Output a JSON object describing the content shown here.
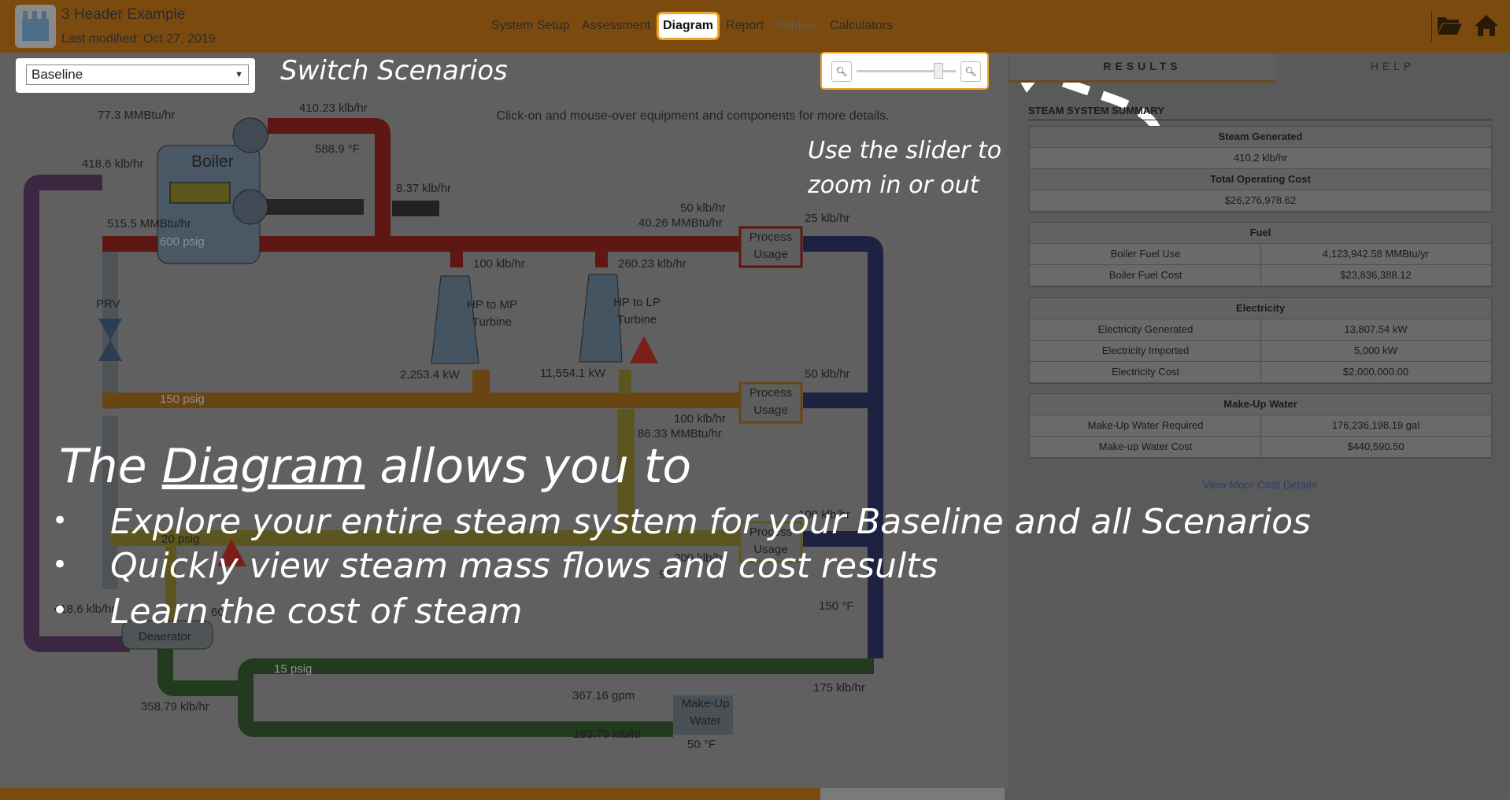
{
  "header": {
    "doc_title": "3 Header Example",
    "last_modified": "Last modified: Oct 27, 2019",
    "nav": [
      "System Setup",
      "Assessment",
      "Diagram",
      "Report",
      "Sankey",
      "Calculators"
    ]
  },
  "scenario": {
    "selected": "Baseline"
  },
  "annotations": {
    "switch_scenarios": "Switch Scenarios",
    "zoom_hint_1": "Use the slider to",
    "zoom_hint_2": "zoom in or out"
  },
  "diagram": {
    "helper": "Click-on and mouse-over equipment and components for more details.",
    "boiler": "Boiler",
    "prv": "PRV",
    "deaerator": "Deaerator",
    "makeup": "Make-Up Water",
    "process_usage": "Process Usage",
    "turbine_hp_mp": "HP to MP Turbine",
    "turbine_hp_lp": "HP to LP Turbine",
    "labels": {
      "boiler_fuel": "77.3 MMBtu/hr",
      "boiler_steam": "410.23 klb/hr",
      "boiler_temp": "588.9 °F",
      "feed_flow": "418.6 klb/hr",
      "blowdown": "8.37 klb/hr",
      "boiler_energy": "515.5 MMBtu/hr",
      "hp_header": "600 psig",
      "hp_process_flow": "50 klb/hr",
      "hp_process_energy": "40.26 MMBtu/hr",
      "hp_process_return": "25 klb/hr",
      "turbine1_flow": "100 klb/hr",
      "turbine2_flow": "260.23 klb/hr",
      "turbine1_power": "2,253.4 kW",
      "turbine2_power": "11,554.1 kW",
      "mp_header": "150 psig",
      "mp_process_return": "50 klb/hr",
      "mp_process_flow": "100 klb/hr",
      "mp_process_energy": "86.33 MMBtu/hr",
      "lp_header": "20 psig",
      "lp_process_return": "100 klb/hr",
      "lp_flow": "200 klb/hr",
      "lp_energy": "96",
      "deaerator_flow": "418.6 klb/hr",
      "deaerator_vent": "60",
      "condensate_temp": "150 °F",
      "cond_header": "15 psig",
      "return_flow": "175 klb/hr",
      "deaerator_out": "358.79 klb/hr",
      "makeup_gpm": "367.16 gpm",
      "makeup_flow": "183.79 klb/hr",
      "makeup_temp": "50 °F"
    }
  },
  "results": {
    "tabs": [
      "RESULTS",
      "HELP"
    ],
    "summary_title": "STEAM SYSTEM SUMMARY",
    "steam_generated_label": "Steam Generated",
    "steam_generated": "410.2 klb/hr",
    "total_cost_label": "Total Operating Cost",
    "total_cost": "$26,276,978.62",
    "fuel": {
      "title": "Fuel",
      "rows": [
        [
          "Boiler Fuel Use",
          "4,123,942.58 MMBtu/yr"
        ],
        [
          "Boiler Fuel Cost",
          "$23,836,388.12"
        ]
      ]
    },
    "electricity": {
      "title": "Electricity",
      "rows": [
        [
          "Electricity Generated",
          "13,807.54 kW"
        ],
        [
          "Electricity Imported",
          "5,000 kW"
        ],
        [
          "Electricity Cost",
          "$2,000,000.00"
        ]
      ]
    },
    "makeup": {
      "title": "Make-Up Water",
      "rows": [
        [
          "Make-Up Water Required",
          "176,236,198.19 gal"
        ],
        [
          "Make-up Water Cost",
          "$440,590.50"
        ]
      ]
    },
    "view_more": "View More Cost Details"
  },
  "overlay": {
    "title_pre": "The ",
    "title_link": "Diagram",
    "title_post": " allows you to",
    "items": [
      "Explore your entire steam system for your Baseline and all Scenarios",
      "Quickly view steam mass flows and cost results",
      "Learn the cost of steam"
    ]
  }
}
